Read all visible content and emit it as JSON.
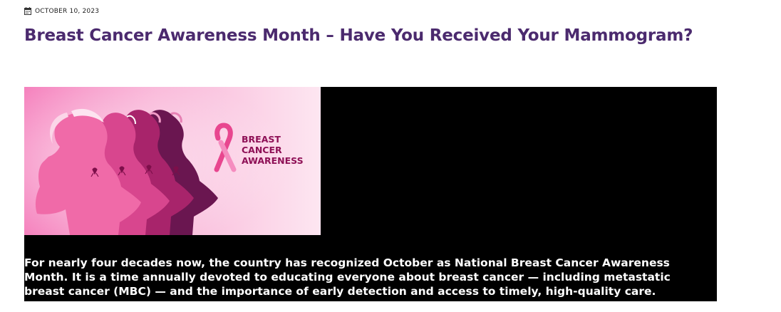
{
  "post": {
    "date": "OCTOBER 10, 2023",
    "date_icon": "calendar-icon",
    "title": "Breast Cancer Awareness Month – Have You Received Your Mammogram?",
    "hero": {
      "line1": "BREAST",
      "line2": "CANCER",
      "line3": "AWARENESS",
      "icon": "pink-ribbon-icon",
      "colors": {
        "background_light": "#fbe0ee",
        "background_pink": "#f48cc0",
        "accent": "#8e1056"
      }
    },
    "intro": "For nearly four decades now, the country has recognized October as National Breast Cancer Awareness Month. It is a time annually devoted to educating everyone about breast cancer — including metastatic breast cancer (MBC) — and the importance of early detection and access to timely, high-quality care."
  },
  "colors": {
    "title": "#4b2a6e",
    "content_background": "#000000",
    "content_text": "#ffffff"
  }
}
